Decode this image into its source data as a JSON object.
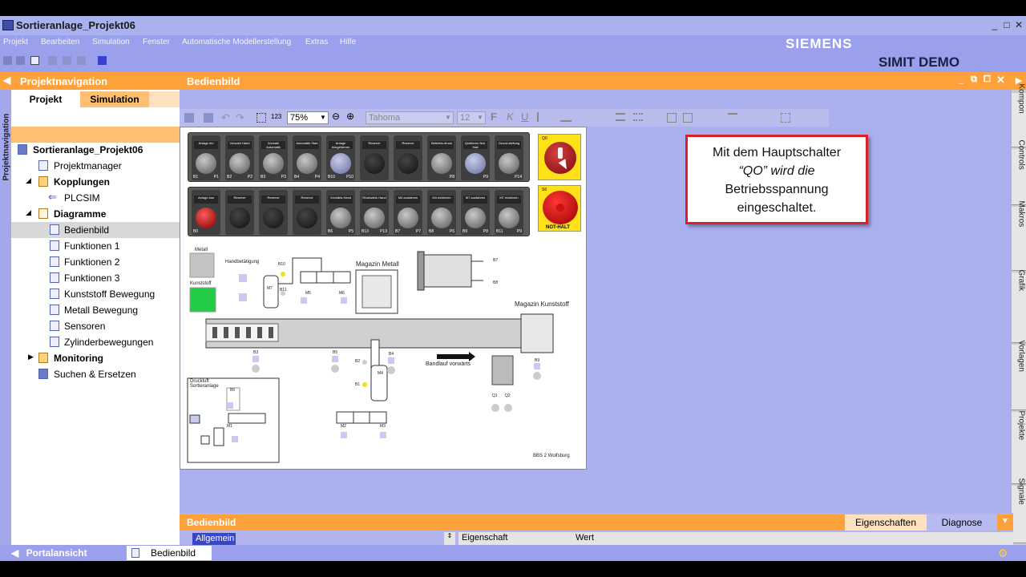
{
  "window": {
    "title": "Sortieranlage_Projekt06",
    "controls": [
      "_",
      "□",
      "✕"
    ]
  },
  "menu": [
    "Projekt",
    "Bearbeiten",
    "Simulation",
    "Fenster",
    "Automatische Modellerstellung",
    "Extras",
    "Hilfe"
  ],
  "brand": "SIEMENS",
  "product": "SIMIT DEMO",
  "left_panel": {
    "title": "Projektnavigation",
    "side_label": "Projektnavigation",
    "tabs": [
      "Projekt",
      "Simulation"
    ],
    "active_tab": "Simulation",
    "tree": [
      {
        "label": "Sortieranlage_Projekt06",
        "level": 0,
        "bold": true
      },
      {
        "label": "Projektmanager",
        "level": 1
      },
      {
        "label": "Kopplungen",
        "level": 1,
        "bold": true,
        "expanded": true
      },
      {
        "label": "PLCSIM",
        "level": 2
      },
      {
        "label": "Diagramme",
        "level": 1,
        "bold": true,
        "expanded": true
      },
      {
        "label": "Bedienbild",
        "level": 2,
        "selected": true
      },
      {
        "label": "Funktionen 1",
        "level": 2
      },
      {
        "label": "Funktionen 2",
        "level": 2
      },
      {
        "label": "Funktionen 3",
        "level": 2
      },
      {
        "label": "Kunststoff Bewegung",
        "level": 2
      },
      {
        "label": "Metall Bewegung",
        "level": 2
      },
      {
        "label": "Sensoren",
        "level": 2
      },
      {
        "label": "Zylinderbewegungen",
        "level": 2
      },
      {
        "label": "Monitoring",
        "level": 1,
        "bold": true,
        "expanded": false
      },
      {
        "label": "Suchen & Ersetzen",
        "level": 1
      }
    ]
  },
  "editor": {
    "title": "Bedienbild",
    "zoom": "75%",
    "font": "Tahoma",
    "font_size": "12",
    "counter": "123"
  },
  "button_panel": {
    "row1": [
      {
        "label": "Anlage ein",
        "num": "B1",
        "out": "P1",
        "knob": "gray"
      },
      {
        "label": "Vorwahl Hand",
        "num": "B2",
        "out": "P2",
        "knob": "gray"
      },
      {
        "label": "Vorwahl Automatik",
        "num": "B3",
        "out": "P3",
        "knob": "gray"
      },
      {
        "label": "Automatik Start",
        "num": "B4",
        "out": "P4",
        "knob": "gray"
      },
      {
        "label": "Anlage leergefahren",
        "num": "B10",
        "out": "P10",
        "knob": "blue"
      },
      {
        "label": "Reserve",
        "num": "",
        "out": "",
        "knob": "dark"
      },
      {
        "label": "Reserve",
        "num": "",
        "out": "",
        "knob": "dark"
      },
      {
        "label": "Betriebs-druck",
        "num": "",
        "out": "P8",
        "knob": "gray"
      },
      {
        "label": "Quittieren Not-Halt",
        "num": "",
        "out": "P9",
        "knob": "blue"
      },
      {
        "label": "Grund-stellung",
        "num": "",
        "out": "P14",
        "knob": "gray"
      }
    ],
    "row2": [
      {
        "label": "Anlage aus",
        "num": "B0",
        "out": "",
        "knob": "red"
      },
      {
        "label": "Reserve",
        "num": "",
        "out": "",
        "knob": "dark"
      },
      {
        "label": "Reserve",
        "num": "",
        "out": "",
        "knob": "dark"
      },
      {
        "label": "Reserve",
        "num": "",
        "out": "",
        "knob": "dark"
      },
      {
        "label": "Vorwärts Hand",
        "num": "B6",
        "out": "P5",
        "knob": "gray"
      },
      {
        "label": "Rückwärts Hand",
        "num": "B13",
        "out": "P13",
        "knob": "gray"
      },
      {
        "label": "M4 ausfahren",
        "num": "B7",
        "out": "P7",
        "knob": "gray"
      },
      {
        "label": "M4 einfahren",
        "num": "B8",
        "out": "P6",
        "knob": "gray"
      },
      {
        "label": "M7 ausfahren",
        "num": "B9",
        "out": "P8",
        "knob": "gray"
      },
      {
        "label": "M7 einfahren",
        "num": "B11",
        "out": "P9",
        "knob": "gray"
      }
    ],
    "main_switch": {
      "tag": "Q0"
    },
    "emergency": {
      "tag": "S6",
      "label": "NOT-HALT"
    }
  },
  "plant": {
    "metall": "Metall",
    "kunststoff": "Kunststoff",
    "handbetaetigung": "Handbetätigung",
    "magazin_metall": "Magazin Metall",
    "magazin_kunststoff": "Magazin Kunststoff",
    "bandlauf": "Bandlauf vorwärts",
    "druckluft": "Druckluft Sortieranlage",
    "footer": "BBS 2 Wolfsburg",
    "tags": {
      "b10": "B10",
      "b11": "B11",
      "m7": "M7",
      "m5": "M5",
      "m6": "M6",
      "b7": "B7",
      "b8": "B8",
      "b3": "B3",
      "b5": "B5",
      "b4": "B4",
      "b2": "B2",
      "b1": "B1",
      "m4": "M4",
      "m2": "M2",
      "m3": "M3",
      "b9": "B9",
      "q1": "Q1",
      "q2": "Q2",
      "b6": "B6",
      "m1": "M1"
    }
  },
  "callout": {
    "line1": "Mit dem Hauptschalter",
    "line2": "“QO” wird die",
    "line3": "Betriebsspannung",
    "line4": "eingeschaltet."
  },
  "right_tabs": [
    "Kompon",
    "Controls",
    "Makros",
    "Grafik",
    "Vorlagen",
    "Projekte",
    "Signale"
  ],
  "bottom_panel": {
    "title": "Bedienbild",
    "tabs": [
      "Eigenschaften",
      "Diagnose"
    ],
    "section": "Allgemein",
    "col_property": "Eigenschaft",
    "col_value": "Wert"
  },
  "statusbar": {
    "portal": "Portalansicht",
    "open_tab": "Bedienbild"
  }
}
